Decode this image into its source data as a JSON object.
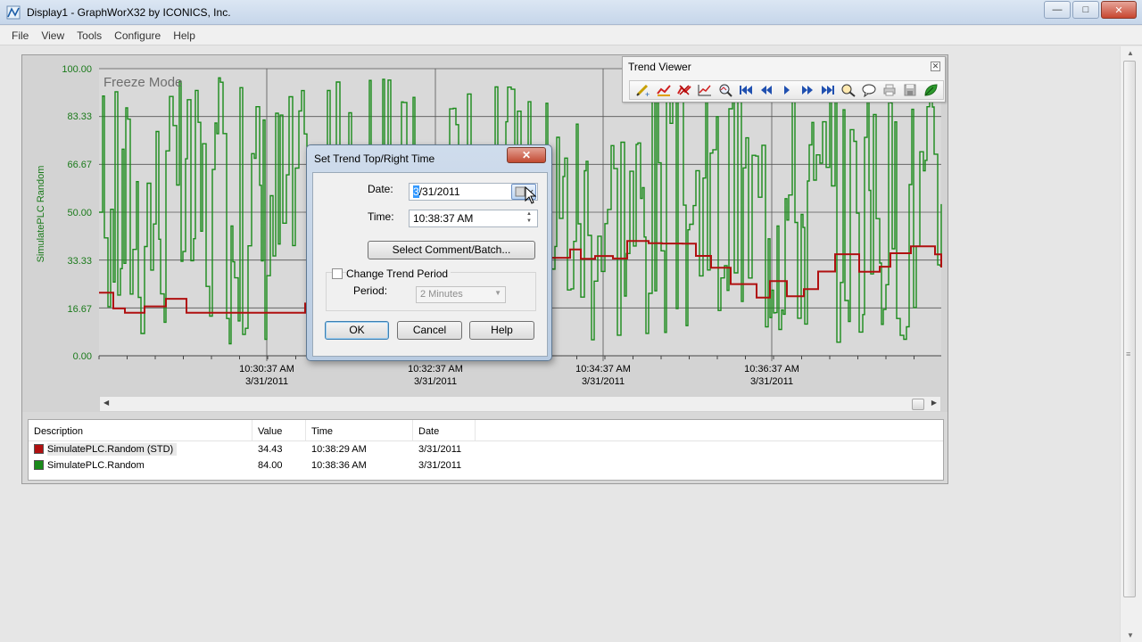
{
  "window": {
    "title": "Display1 - GraphWorX32 by ICONICS, Inc.",
    "minimize_glyph": "—",
    "maximize_glyph": "□",
    "close_glyph": "✕"
  },
  "menu": [
    "File",
    "View",
    "Tools",
    "Configure",
    "Help"
  ],
  "trend": {
    "mode_label": "Freeze Mode",
    "y_axis_label": "SimulatePLC Random",
    "y_ticks": [
      "100.00",
      "83.33",
      "66.67",
      "50.00",
      "33.33",
      "16.67",
      "0.00"
    ],
    "x_ticks": [
      {
        "time": "10:30:37 AM",
        "date": "3/31/2011"
      },
      {
        "time": "10:32:37 AM",
        "date": "3/31/2011"
      },
      {
        "time": "10:34:37 AM",
        "date": "3/31/2011"
      },
      {
        "time": "10:36:37 AM",
        "date": "3/31/2011"
      }
    ],
    "series_colors": {
      "random": "#1a8a1a",
      "std": "#b01010"
    }
  },
  "legend": {
    "headers": {
      "description": "Description",
      "value": "Value",
      "time": "Time",
      "date": "Date"
    },
    "rows": [
      {
        "description": "SimulatePLC.Random (STD)",
        "value": "34.43",
        "time": "10:38:29 AM",
        "date": "3/31/2011",
        "color": "#b01010"
      },
      {
        "description": "SimulatePLC.Random",
        "value": "84.00",
        "time": "10:38:36 AM",
        "date": "3/31/2011",
        "color": "#1a8a1a"
      }
    ]
  },
  "trend_viewer": {
    "title": "Trend Viewer",
    "close_glyph": "✕",
    "icons": [
      "add-pen-icon",
      "edit-pen-icon",
      "delete-pen-icon",
      "chart-icon",
      "zoom-icon",
      "first-icon",
      "rewind-icon",
      "play-icon",
      "fast-forward-icon",
      "last-icon",
      "magnify-icon",
      "comment-icon",
      "print-icon",
      "save-icon",
      "leaf-icon"
    ]
  },
  "dialog": {
    "title": "Set Trend Top/Right Time",
    "close_glyph": "✕",
    "date_label": "Date:",
    "date_value_selected": "3",
    "date_value_rest": "/31/2011",
    "time_label": "Time:",
    "time_value": "10:38:37 AM",
    "select_comment_label": "Select Comment/Batch...",
    "change_period_label": "Change Trend Period",
    "period_label": "Period:",
    "period_value": "2 Minutes",
    "ok_label": "OK",
    "cancel_label": "Cancel",
    "help_label": "Help"
  }
}
